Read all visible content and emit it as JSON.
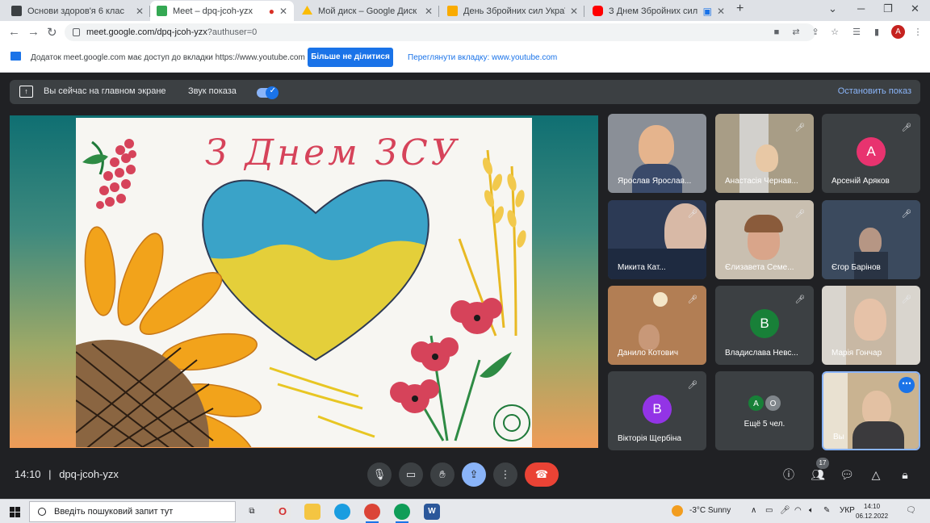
{
  "browser": {
    "tabs": [
      {
        "title": "Основи здоров'я 6 клас",
        "color": "#3c4043",
        "active": false
      },
      {
        "title": "Meet – dpq-jcoh-yzx",
        "color": "#34a853",
        "active": true
      },
      {
        "title": "Мой диск – Google Диск",
        "color": "#fbbc04",
        "active": false
      },
      {
        "title": "День Збройних сил України.ppt",
        "color": "#f9ab00",
        "active": false
      },
      {
        "title": "З Днем Збройних сил Укра",
        "color": "#ff0000",
        "active": false
      }
    ],
    "new_tab_symbol": "+",
    "url_host": "meet.google.com/dpq-jcoh-yzx",
    "url_rest": "?authuser=0",
    "profile_initial": "A"
  },
  "share_banner": {
    "message": "Додаток meet.google.com має доступ до вкладки https://www.youtube.com",
    "stop_sharing_label": "Більше не ділитися",
    "switch_tab_label": "Переглянути вкладку: www.youtube.com"
  },
  "presentation_bar": {
    "status": "Вы сейчас на главном экране",
    "audio_label": "Звук показа",
    "audio_on": true,
    "stop_label": "Остановить показ"
  },
  "shared_screen": {
    "drawing_title": "З Днем ЗСУ"
  },
  "participants": [
    {
      "name": "Ярослав Ярослав...",
      "muted": false,
      "kind": "video",
      "bg": "#8a8f97",
      "skin": "#e5b48d"
    },
    {
      "name": "Анастасія Чернав...",
      "muted": true,
      "kind": "video",
      "bg": "#a89d86",
      "skin": "#e8c8a5"
    },
    {
      "name": "Арсеній Аряков",
      "muted": true,
      "kind": "avatar",
      "initial": "A",
      "color": "#e8336f"
    },
    {
      "name": "Микита Кат...",
      "muted": true,
      "kind": "video",
      "bg": "#2c3a55",
      "skin": "#d8b9a6"
    },
    {
      "name": "Єлизавета Семе...",
      "muted": true,
      "kind": "video",
      "bg": "#c9bfb0",
      "skin": "#d9a58a"
    },
    {
      "name": "Єгор Барінов",
      "muted": true,
      "kind": "video",
      "bg": "#3b4a5e",
      "skin": "#b69684"
    },
    {
      "name": "Данило Котович",
      "muted": true,
      "kind": "video",
      "bg": "#b27e54",
      "skin": "#c89878"
    },
    {
      "name": "Владислава Невс...",
      "muted": true,
      "kind": "avatar",
      "initial": "B",
      "color": "#188038"
    },
    {
      "name": "Марія Гончар",
      "muted": true,
      "kind": "video",
      "bg": "#d9d5ce",
      "skin": "#e6c2a8"
    },
    {
      "name": "Вікторія Щербіна",
      "muted": true,
      "kind": "avatar",
      "initial": "B",
      "color": "#9334e6"
    },
    {
      "name": "Ещё 5 чел.",
      "muted": false,
      "kind": "more",
      "initials": [
        "A",
        "O"
      ],
      "colors": [
        "#188038",
        "#80868b"
      ]
    },
    {
      "name": "Вы",
      "muted": false,
      "kind": "self",
      "bg": "#c9b391",
      "skin": "#e3c1a3"
    }
  ],
  "meeting": {
    "time": "14:10",
    "code": "dpq-jcoh-yzx",
    "participant_count": "17"
  },
  "taskbar": {
    "search_placeholder": "Введіть пошуковий запит тут",
    "weather": "-3°C Sunny",
    "language": "УКР",
    "time": "14:10",
    "date": "06.12.2022"
  }
}
